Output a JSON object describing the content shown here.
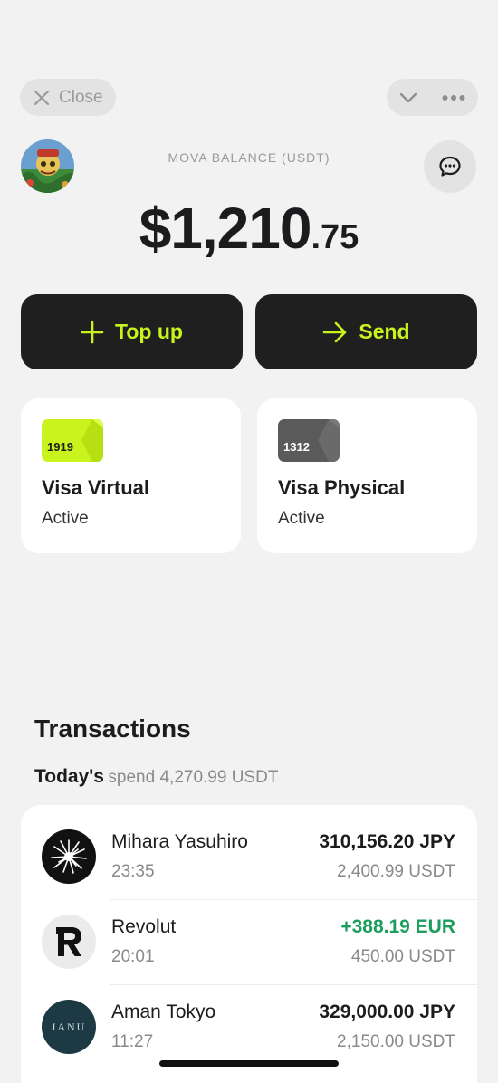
{
  "topbar": {
    "close_label": "Close"
  },
  "header": {
    "balance_label": "MOVA BALANCE (USDT)",
    "balance_main": "$1,210",
    "balance_cents": ".75"
  },
  "actions": {
    "topup_label": "Top up",
    "send_label": "Send"
  },
  "cards": [
    {
      "number": "1919",
      "title": "Visa Virtual",
      "status": "Active",
      "color": "#c8f31d"
    },
    {
      "number": "1312",
      "title": "Visa Physical",
      "status": "Active",
      "color": "#5e5e5e"
    }
  ],
  "transactions": {
    "heading": "Transactions",
    "today_label": "Today's",
    "today_spend": "spend 4,270.99 USDT",
    "items": [
      {
        "name": "Mihara Yasuhiro",
        "time": "23:35",
        "amount": "310,156.20 JPY",
        "usdt": "2,400.99 USDT",
        "logo": "burst-logo"
      },
      {
        "name": "Revolut",
        "time": "20:01",
        "amount": "+388.19 EUR",
        "usdt": "450.00 USDT",
        "logo": "revolut-logo"
      },
      {
        "name": "Aman Tokyo",
        "time": "11:27",
        "amount": "329,000.00 JPY",
        "usdt": "2,150.00 USDT",
        "logo": "janu-logo",
        "logo_text": "JANU"
      }
    ]
  },
  "colors": {
    "accent": "#c8f31d",
    "positive": "#1d9e5e",
    "dark_button": "#1f1f1f"
  }
}
